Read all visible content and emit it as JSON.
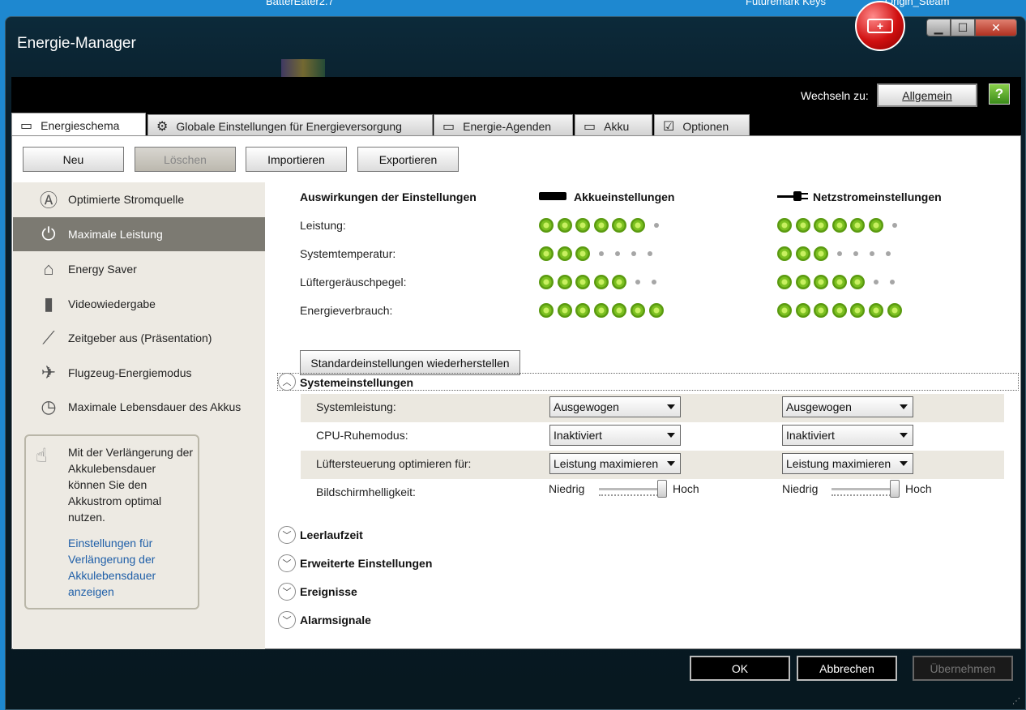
{
  "desktop": {
    "label_left": "BatterEater2.7",
    "label_mid": "Futuremark Keys",
    "label_right": "Origin_Steam"
  },
  "window": {
    "title": "Energie-Manager",
    "min": "▁",
    "max": "☐",
    "close": "✕"
  },
  "header": {
    "switch_label": "Wechseln zu:",
    "switch_button": "Allgemein",
    "help_icon": "?"
  },
  "tabs": [
    {
      "label": "Energieschema",
      "icon": "laptop-icon"
    },
    {
      "label": "Globale Einstellungen für Energieversorgung",
      "icon": "gear-icon"
    },
    {
      "label": "Energie-Agenden",
      "icon": "calendar-clock-icon"
    },
    {
      "label": "Akku",
      "icon": "battery-icon"
    },
    {
      "label": "Optionen",
      "icon": "checkbox-icon"
    }
  ],
  "toolbar": {
    "new": "Neu",
    "delete": "Löschen",
    "import": "Importieren",
    "export": "Exportieren"
  },
  "sidebar": {
    "items": [
      {
        "label": "Optimierte Stromquelle",
        "icon": "auto-icon"
      },
      {
        "label": "Maximale Leistung",
        "icon": "power-icon"
      },
      {
        "label": "Energy Saver",
        "icon": "house-icon"
      },
      {
        "label": "Videowiedergabe",
        "icon": "film-icon"
      },
      {
        "label": "Zeitgeber aus (Präsentation)",
        "icon": "projector-icon"
      },
      {
        "label": "Flugzeug-Energiemodus",
        "icon": "airplane-icon"
      },
      {
        "label": "Maximale Lebensdauer des Akkus",
        "icon": "battery-clock-icon"
      }
    ],
    "tip_text": "Mit der Verlängerung der Akkulebensdauer können Sie den Akkustrom optimal nutzen.",
    "tip_link": "Einstellungen für Verlängerung der Akkulebensdauer anzeigen"
  },
  "effects": {
    "heading": "Auswirkungen der Einstellungen",
    "battery_heading": "Akkueinstellungen",
    "ac_heading": "Netzstromeinstellungen",
    "rows": [
      {
        "label": "Leistung:",
        "battery_level": 6,
        "ac_level": 6,
        "max": 7
      },
      {
        "label": "Systemtemperatur:",
        "battery_level": 3,
        "ac_level": 3,
        "max": 7
      },
      {
        "label": "Lüftergeräuschpegel:",
        "battery_level": 5,
        "ac_level": 5,
        "max": 7
      },
      {
        "label": "Energieverbrauch:",
        "battery_level": 7,
        "ac_level": 7,
        "max": 7
      }
    ],
    "restore_button": "Standardeinstellungen wiederherstellen"
  },
  "system_settings": {
    "heading": "Systemeinstellungen",
    "rows": [
      {
        "label": "Systemleistung:",
        "battery": "Ausgewogen",
        "ac": "Ausgewogen"
      },
      {
        "label": "CPU-Ruhemodus:",
        "battery": "Inaktiviert",
        "ac": "Inaktiviert"
      },
      {
        "label": "Lüftersteuerung optimieren für:",
        "battery": "Leistung maximieren",
        "ac": "Leistung maximieren"
      }
    ],
    "brightness": {
      "label": "Bildschirmhelligkeit:",
      "low": "Niedrig",
      "high": "Hoch",
      "battery_value": 1.0,
      "ac_value": 1.0
    }
  },
  "sections": [
    "Leerlaufzeit",
    "Erweiterte Einstellungen",
    "Ereignisse",
    "Alarmsignale"
  ],
  "footer": {
    "ok": "OK",
    "cancel": "Abbrechen",
    "apply": "Übernehmen"
  }
}
